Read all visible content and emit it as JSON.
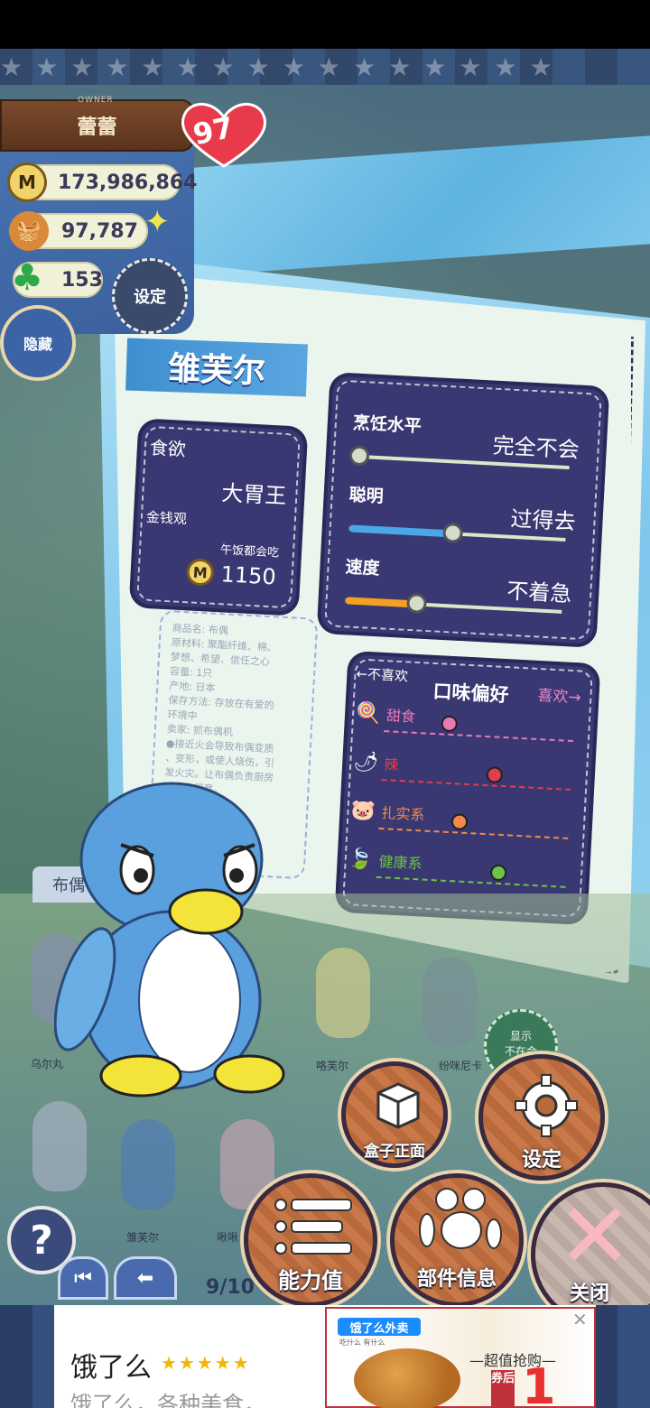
{
  "owner": {
    "caption": "OWNER",
    "name": "蕾蕾",
    "level": "97",
    "coins": "173,986,864",
    "items": "97,787",
    "clovers": "153",
    "hide_label": "隐藏",
    "settings_label": "设定"
  },
  "character": {
    "name": "雏芙尔",
    "appetite_label": "食欲",
    "appetite_value": "大胃王",
    "money_label": "金钱观",
    "money_value": "午饭都会吃",
    "price": "1150",
    "stats": [
      {
        "label": "烹饪水平",
        "value": "完全不会",
        "level": 0.0
      },
      {
        "label": "聪明",
        "value": "过得去",
        "level": 0.45
      },
      {
        "label": "速度",
        "value": "不着急",
        "level": 0.3
      }
    ],
    "taste": {
      "title": "口味偏好",
      "dislike": "←不喜欢",
      "like": "喜欢→",
      "items": [
        {
          "label": "甜食",
          "level": 0.3,
          "color": "#e879b6"
        },
        {
          "label": "辣",
          "level": 0.55,
          "color": "#e23d4a"
        },
        {
          "label": "扎实系",
          "level": 0.38,
          "color": "#f08a4a"
        },
        {
          "label": "健康系",
          "level": 0.6,
          "color": "#6cc24a"
        }
      ]
    },
    "notes": "商品名: 布偶\n原材料: 聚酯纤维、棉、\n梦想、希望、信任之心\n容量: 1只\n产地: 日本\n保存方法: 存放在有爱的\n环境中\n卖家: 抓布偶机\n●接近火会导致布偶变质\n、变形，或使人烧伤，引\n发火灾。让布偶负责厨房\n请十分留意。\n●会褪色，蹭色\n因此请勿\n布偶洗涤"
  },
  "collection": {
    "tab": "布偶",
    "dolls": [
      "乌尔丸",
      "咯芙尔",
      "纷咪尼卡",
      "雏芙尔",
      "啾啾"
    ],
    "absent": "显示\n不在会"
  },
  "buttons": {
    "box_front": "盒子正面",
    "settings": "设定",
    "abilities": "能力值",
    "parts": "部件信息",
    "close": "关闭",
    "help": "?",
    "first": "⏮",
    "prev": "⬅"
  },
  "page": "9/10",
  "ad": {
    "title": "饿了么",
    "stars": "★★★★★",
    "desc": "饿了么，各种美食，",
    "logo": "饿了么外卖",
    "logo_sub": "吃什么 有什么",
    "headline": "—超值抢购—",
    "coupon": "券后",
    "big": "1",
    "close": "✕"
  }
}
